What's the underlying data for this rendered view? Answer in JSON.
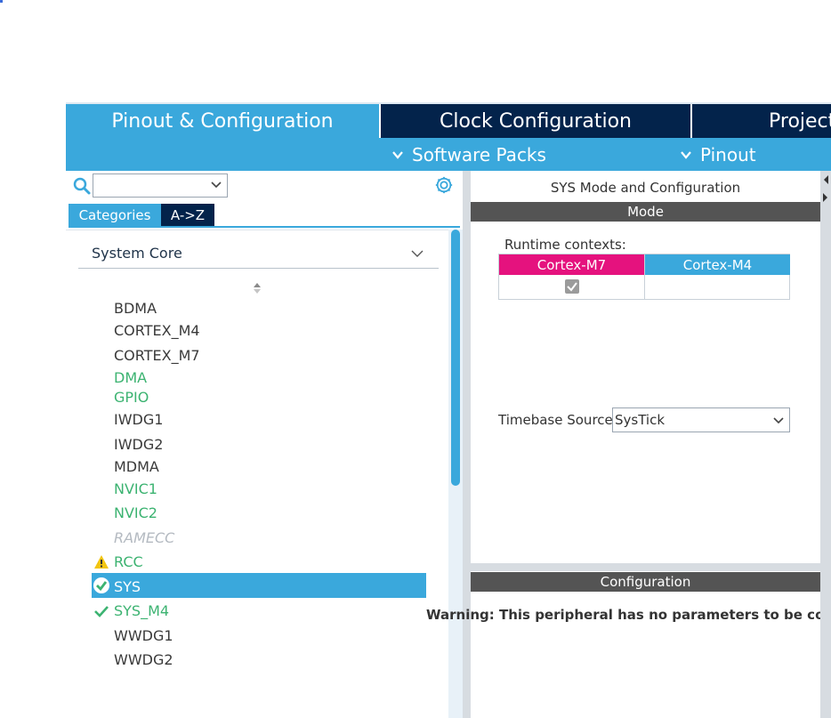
{
  "top_tabs": [
    {
      "label": "Pinout & Configuration",
      "active": true
    },
    {
      "label": "Clock Configuration",
      "active": false
    },
    {
      "label": "Project Manager",
      "active": false
    }
  ],
  "subbar": {
    "software_packs": "Software Packs",
    "pinout": "Pinout"
  },
  "left": {
    "search": {
      "value": "",
      "placeholder": ""
    },
    "categories_button": "Categories",
    "az_button": "A->Z",
    "group_title": "System Core",
    "items": [
      {
        "label": "BDMA",
        "status": "normal"
      },
      {
        "label": "CORTEX_M4",
        "status": "normal"
      },
      {
        "label": "CORTEX_M7",
        "status": "normal"
      },
      {
        "label": "DMA",
        "status": "green"
      },
      {
        "label": "GPIO",
        "status": "green"
      },
      {
        "label": "IWDG1",
        "status": "normal"
      },
      {
        "label": "IWDG2",
        "status": "normal"
      },
      {
        "label": "MDMA",
        "status": "normal"
      },
      {
        "label": "NVIC1",
        "status": "green"
      },
      {
        "label": "NVIC2",
        "status": "green"
      },
      {
        "label": "RAMECC",
        "status": "disabled"
      },
      {
        "label": "RCC",
        "status": "warning"
      },
      {
        "label": "SYS",
        "status": "selected"
      },
      {
        "label": "SYS_M4",
        "status": "checked"
      },
      {
        "label": "WWDG1",
        "status": "normal"
      },
      {
        "label": "WWDG2",
        "status": "normal"
      }
    ]
  },
  "right": {
    "title": "SYS Mode and Configuration",
    "mode_header": "Mode",
    "runtime_contexts_label": "Runtime contexts:",
    "contexts": [
      {
        "label": "Cortex-M7",
        "checked": true,
        "color": "#e5127e"
      },
      {
        "label": "Cortex-M4",
        "checked": false,
        "color": "#3aa8dc"
      }
    ],
    "timebase_label": "Timebase Source",
    "timebase_value": "SysTick",
    "config_header": "Configuration",
    "warning_text": "Warning: This peripheral has no parameters to be configured."
  },
  "colors": {
    "accent": "#3aa8dc",
    "navy": "#03234b",
    "green": "#3cb371",
    "magenta": "#e5127e",
    "warning": "#f2c511"
  }
}
